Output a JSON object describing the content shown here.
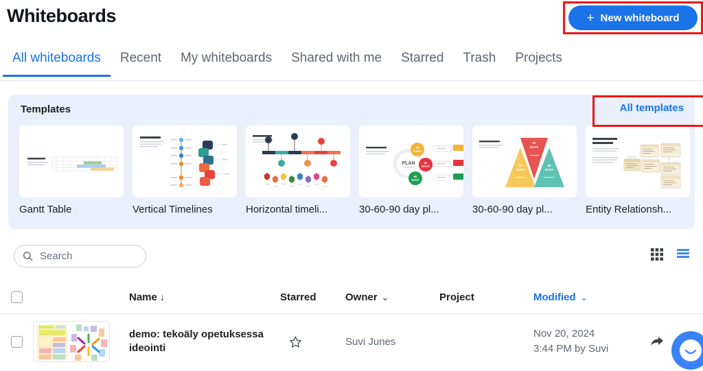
{
  "header": {
    "title": "Whiteboards",
    "new_button_label": "New whiteboard",
    "new_button_icon": "plus-icon",
    "accent_color": "#1a73e8",
    "annotation_color": "#f01414"
  },
  "tabs": [
    {
      "label": "All whiteboards",
      "active": true
    },
    {
      "label": "Recent",
      "active": false
    },
    {
      "label": "My whiteboards",
      "active": false
    },
    {
      "label": "Shared with me",
      "active": false
    },
    {
      "label": "Starred",
      "active": false
    },
    {
      "label": "Trash",
      "active": false
    },
    {
      "label": "Projects",
      "active": false
    }
  ],
  "templates": {
    "title": "Templates",
    "all_link": "All templates",
    "panel_bg": "#e9f0fb",
    "cards": [
      {
        "label": "Gantt Table",
        "kind": "gantt"
      },
      {
        "label": "Vertical Timelines",
        "kind": "vertical-timeline"
      },
      {
        "label": "Horizontal timeli...",
        "kind": "horizontal-timeline"
      },
      {
        "label": "30-60-90 day pl...",
        "kind": "plan-circles"
      },
      {
        "label": "30-60-90 day pl...",
        "kind": "plan-triangles"
      },
      {
        "label": "Entity Relationsh...",
        "kind": "erd"
      }
    ]
  },
  "search": {
    "placeholder": "Search",
    "value": "",
    "icon": "search-icon"
  },
  "view_toggle": {
    "grid_icon": "grid-view-icon",
    "list_icon": "list-view-icon",
    "active": "list",
    "grid_color": "#3c4043",
    "list_color": "#4285f4"
  },
  "table": {
    "columns": {
      "select_all": "",
      "name": "Name",
      "name_sort": "↓",
      "starred": "Starred",
      "owner": "Owner",
      "owner_caret": "⌄",
      "project": "Project",
      "modified": "Modified",
      "modified_caret": "⌄"
    },
    "rows": [
      {
        "name": "demo: tekoäly opetuksessa ideointi",
        "starred": false,
        "owner": "Suvi Junes",
        "project": "",
        "modified_date": "Nov 20, 2024",
        "modified_time": "3:44 PM by Suvi",
        "thumbnail": "sticky-note-board"
      }
    ]
  },
  "help_widget": {
    "icon": "chat-smile-icon",
    "color": "#3b82f6"
  }
}
